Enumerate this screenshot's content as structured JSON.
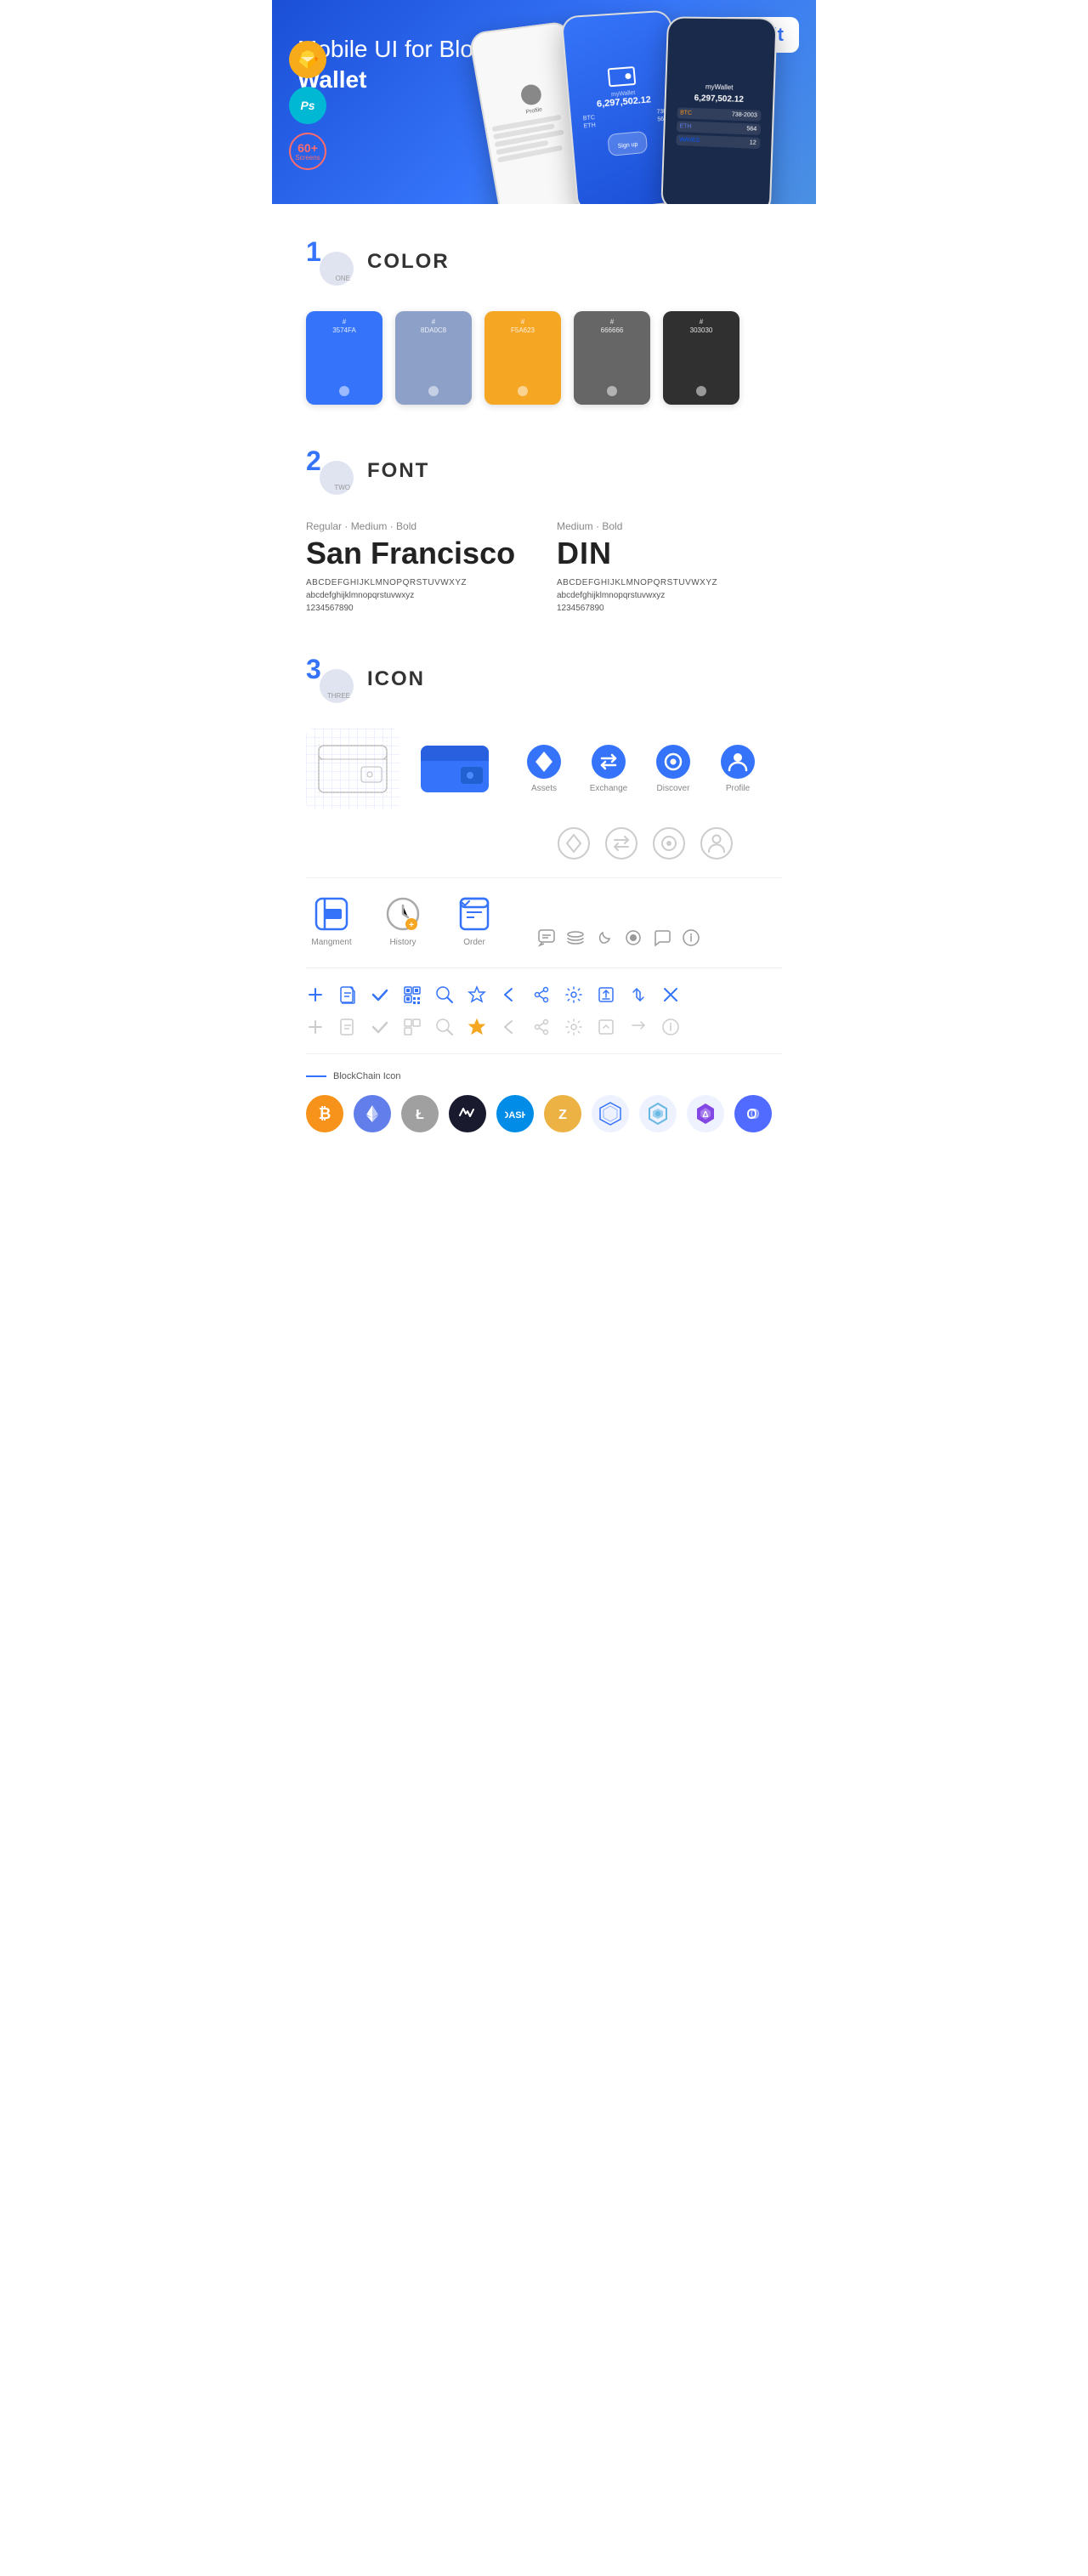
{
  "hero": {
    "title_regular": "Mobile UI for Blockchain ",
    "title_bold": "Wallet",
    "badge": "UI Kit",
    "sketch_label": "S",
    "ps_label": "Ps",
    "screens_count": "60+",
    "screens_label": "Screens"
  },
  "sections": {
    "color": {
      "number": "1",
      "sub": "ONE",
      "title": "COLOR",
      "swatches": [
        {
          "hex": "#3574FA",
          "code": "#\n3574FA"
        },
        {
          "hex": "#8DA0C8",
          "code": "#\n8DA0C8"
        },
        {
          "hex": "#F5A623",
          "code": "#\nF5A623"
        },
        {
          "hex": "#666666",
          "code": "#\n666666"
        },
        {
          "hex": "#303030",
          "code": "#\n303030"
        }
      ]
    },
    "font": {
      "number": "2",
      "sub": "TWO",
      "title": "FONT",
      "font1": {
        "style": "Regular · Medium · Bold",
        "name": "San Francisco",
        "chars_upper": "ABCDEFGHIJKLMNOPQRSTUVWXYZ",
        "chars_lower": "abcdefghijklmnopqrstuvwxyz",
        "nums": "1234567890"
      },
      "font2": {
        "style": "Medium · Bold",
        "name": "DIN",
        "chars_upper": "ABCDEFGHIJKLMNOPQRSTUVWXYZ",
        "chars_lower": "abcdefghijklmnopqrstuvwxyz",
        "nums": "1234567890"
      }
    },
    "icon": {
      "number": "3",
      "sub": "THREE",
      "title": "ICON",
      "nav_icons": [
        {
          "label": "Assets"
        },
        {
          "label": "Exchange"
        },
        {
          "label": "Discover"
        },
        {
          "label": "Profile"
        }
      ],
      "app_icons": [
        {
          "label": "Mangment"
        },
        {
          "label": "History"
        },
        {
          "label": "Order"
        }
      ],
      "blockchain_label": "BlockChain Icon",
      "crypto": [
        {
          "label": "BTC",
          "symbol": "₿"
        },
        {
          "label": "ETH",
          "symbol": "Ξ"
        },
        {
          "label": "LTC",
          "symbol": "Ł"
        },
        {
          "label": "WAVES",
          "symbol": "W"
        },
        {
          "label": "DASH",
          "symbol": "D"
        },
        {
          "label": "ZEC",
          "symbol": "Z"
        },
        {
          "label": "IOTA",
          "symbol": "⬡"
        },
        {
          "label": "NEM",
          "symbol": "N"
        },
        {
          "label": "MATIC",
          "symbol": "M"
        },
        {
          "label": "BAND",
          "symbol": "B"
        }
      ]
    }
  }
}
